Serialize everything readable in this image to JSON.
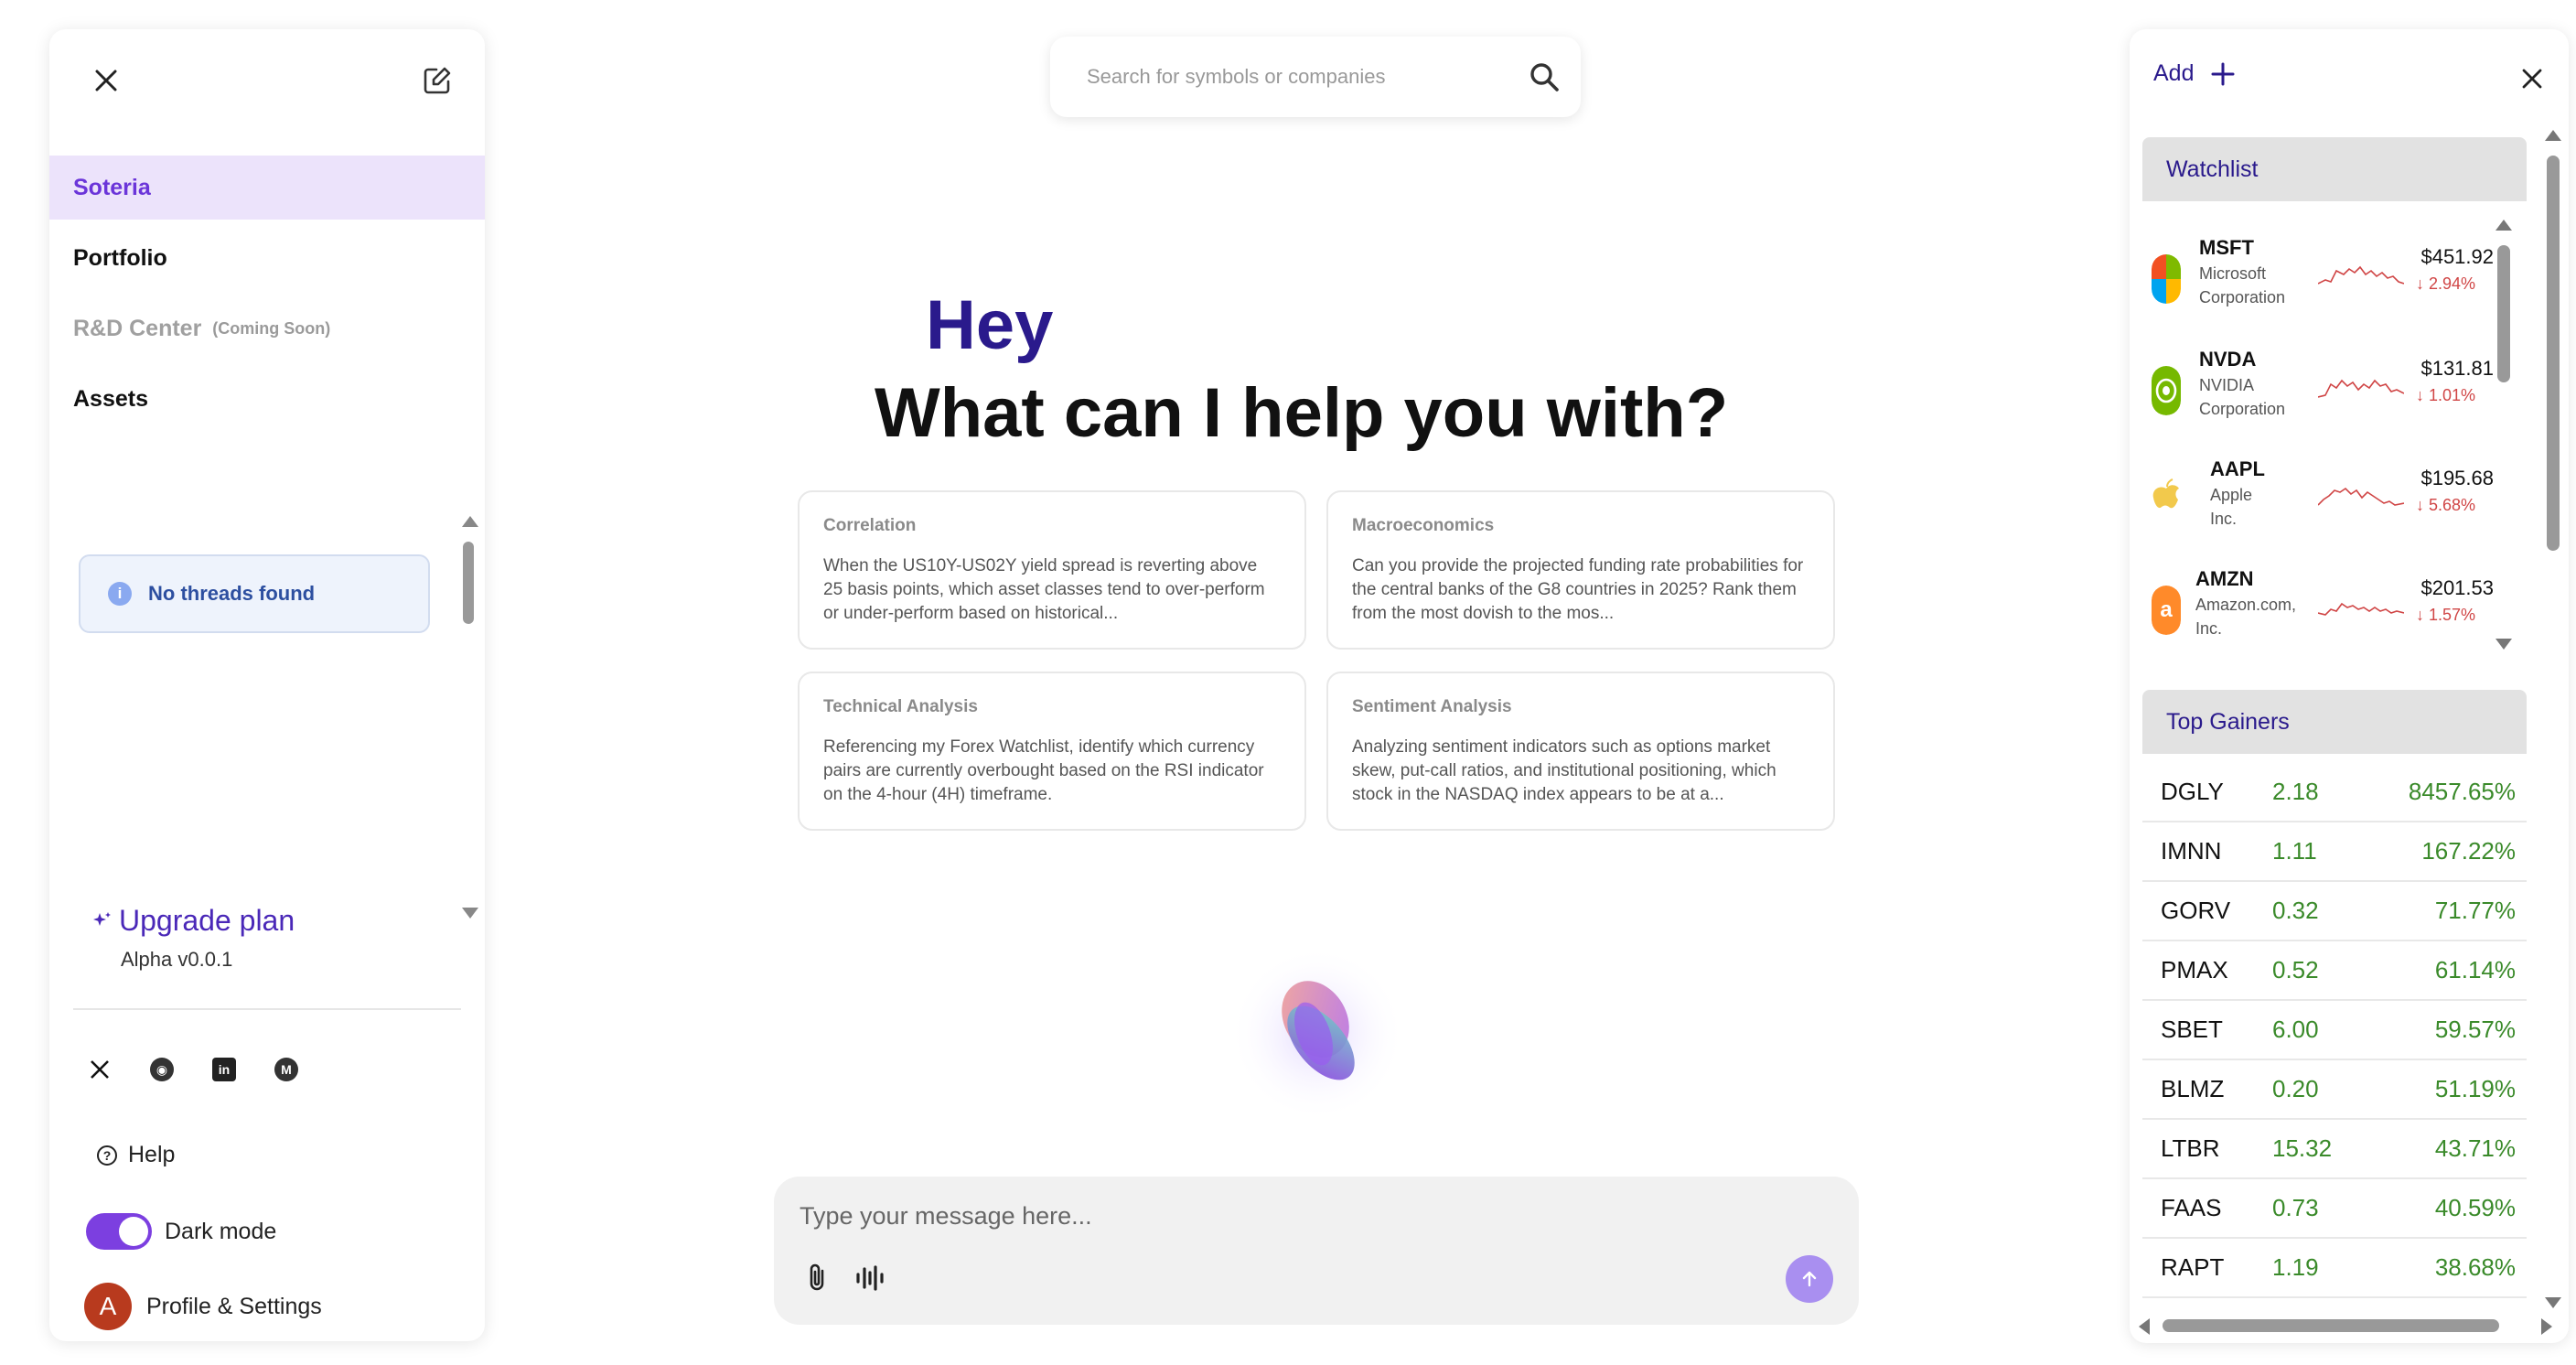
{
  "sidebar": {
    "nav": [
      {
        "label": "Soteria",
        "badge": ""
      },
      {
        "label": "Portfolio",
        "badge": ""
      },
      {
        "label": "R&D Center",
        "badge": "(Coming Soon)"
      },
      {
        "label": "Assets",
        "badge": ""
      }
    ],
    "threads_empty": "No threads found",
    "upgrade_label": "Upgrade plan",
    "version": "Alpha v0.0.1",
    "socials": [
      "x-icon",
      "discord-icon",
      "linkedin-icon",
      "medium-icon"
    ],
    "help_label": "Help",
    "dark_mode_label": "Dark mode",
    "dark_mode_on": true,
    "profile_initial": "A",
    "profile_label": "Profile & Settings"
  },
  "search": {
    "placeholder": "Search for symbols or companies"
  },
  "main": {
    "greeting": "Hey",
    "headline": "What can I help you with?",
    "cards": [
      {
        "title": "Correlation",
        "body": "When the US10Y-US02Y yield spread is reverting above 25 basis points, which asset classes tend to over-perform or under-perform based on historical..."
      },
      {
        "title": "Macroeconomics",
        "body": "Can you provide the projected funding rate probabilities for the central banks of the G8 countries in 2025? Rank them from the most dovish to the mos..."
      },
      {
        "title": "Technical Analysis",
        "body": "Referencing my Forex Watchlist, identify which currency pairs are currently overbought based on the RSI indicator on the 4-hour (4H) timeframe."
      },
      {
        "title": "Sentiment Analysis",
        "body": "Analyzing sentiment indicators such as options market skew, put-call ratios, and institutional positioning, which stock in the NASDAQ index appears to be at a..."
      }
    ],
    "composer_placeholder": "Type your message here..."
  },
  "right_panel": {
    "add_label": "Add",
    "watchlist_title": "Watchlist",
    "watchlist": [
      {
        "ticker": "MSFT",
        "name": "Microsoft Corporation",
        "price": "$451.92",
        "change": "↓ 2.94%",
        "logo": "microsoft-logo"
      },
      {
        "ticker": "NVDA",
        "name": "NVIDIA Corporation",
        "price": "$131.81",
        "change": "↓ 1.01%",
        "logo": "nvidia-logo"
      },
      {
        "ticker": "AAPL",
        "name": "Apple Inc.",
        "price": "$195.68",
        "change": "↓ 5.68%",
        "logo": "apple-logo"
      },
      {
        "ticker": "AMZN",
        "name": "Amazon.com, Inc.",
        "price": "$201.53",
        "change": "↓ 1.57%",
        "logo": "amazon-logo"
      }
    ],
    "gainers_title": "Top Gainers",
    "gainers": [
      {
        "symbol": "DGLY",
        "value": "2.18",
        "pct": "8457.65%"
      },
      {
        "symbol": "IMNN",
        "value": "1.11",
        "pct": "167.22%"
      },
      {
        "symbol": "GORV",
        "value": "0.32",
        "pct": "71.77%"
      },
      {
        "symbol": "PMAX",
        "value": "0.52",
        "pct": "61.14%"
      },
      {
        "symbol": "SBET",
        "value": "6.00",
        "pct": "59.57%"
      },
      {
        "symbol": "BLMZ",
        "value": "0.20",
        "pct": "51.19%"
      },
      {
        "symbol": "LTBR",
        "value": "15.32",
        "pct": "43.71%"
      },
      {
        "symbol": "FAAS",
        "value": "0.73",
        "pct": "40.59%"
      },
      {
        "symbol": "RAPT",
        "value": "1.19",
        "pct": "38.68%"
      }
    ]
  },
  "colors": {
    "accent": "#7c3fe0",
    "brand_text": "#2a1a8c",
    "active_bg": "#ece3fb",
    "gain": "#3a8a2a",
    "loss": "#d04545"
  }
}
